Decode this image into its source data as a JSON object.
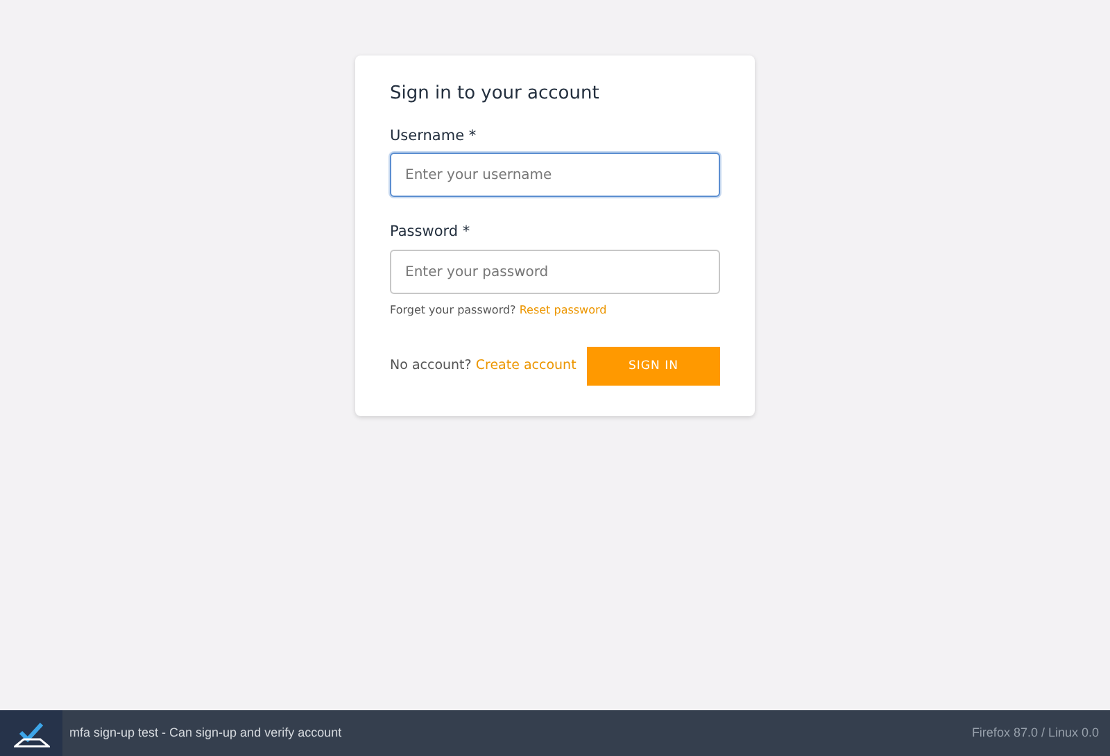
{
  "form": {
    "title": "Sign in to your account",
    "fields": [
      {
        "label": "Username *",
        "placeholder": "Enter your username",
        "focused": true
      },
      {
        "label": "Password *",
        "placeholder": "Enter your password",
        "focused": false
      }
    ],
    "forgot": {
      "text": "Forget your password?",
      "link": "Reset password"
    },
    "signup": {
      "text": "No account?",
      "link": "Create account"
    },
    "submit": "SIGN IN"
  },
  "footer": {
    "test_name": "mfa sign-up test - Can sign-up and verify account",
    "browser": "Firefox 87.0 / Linux 0.0"
  }
}
